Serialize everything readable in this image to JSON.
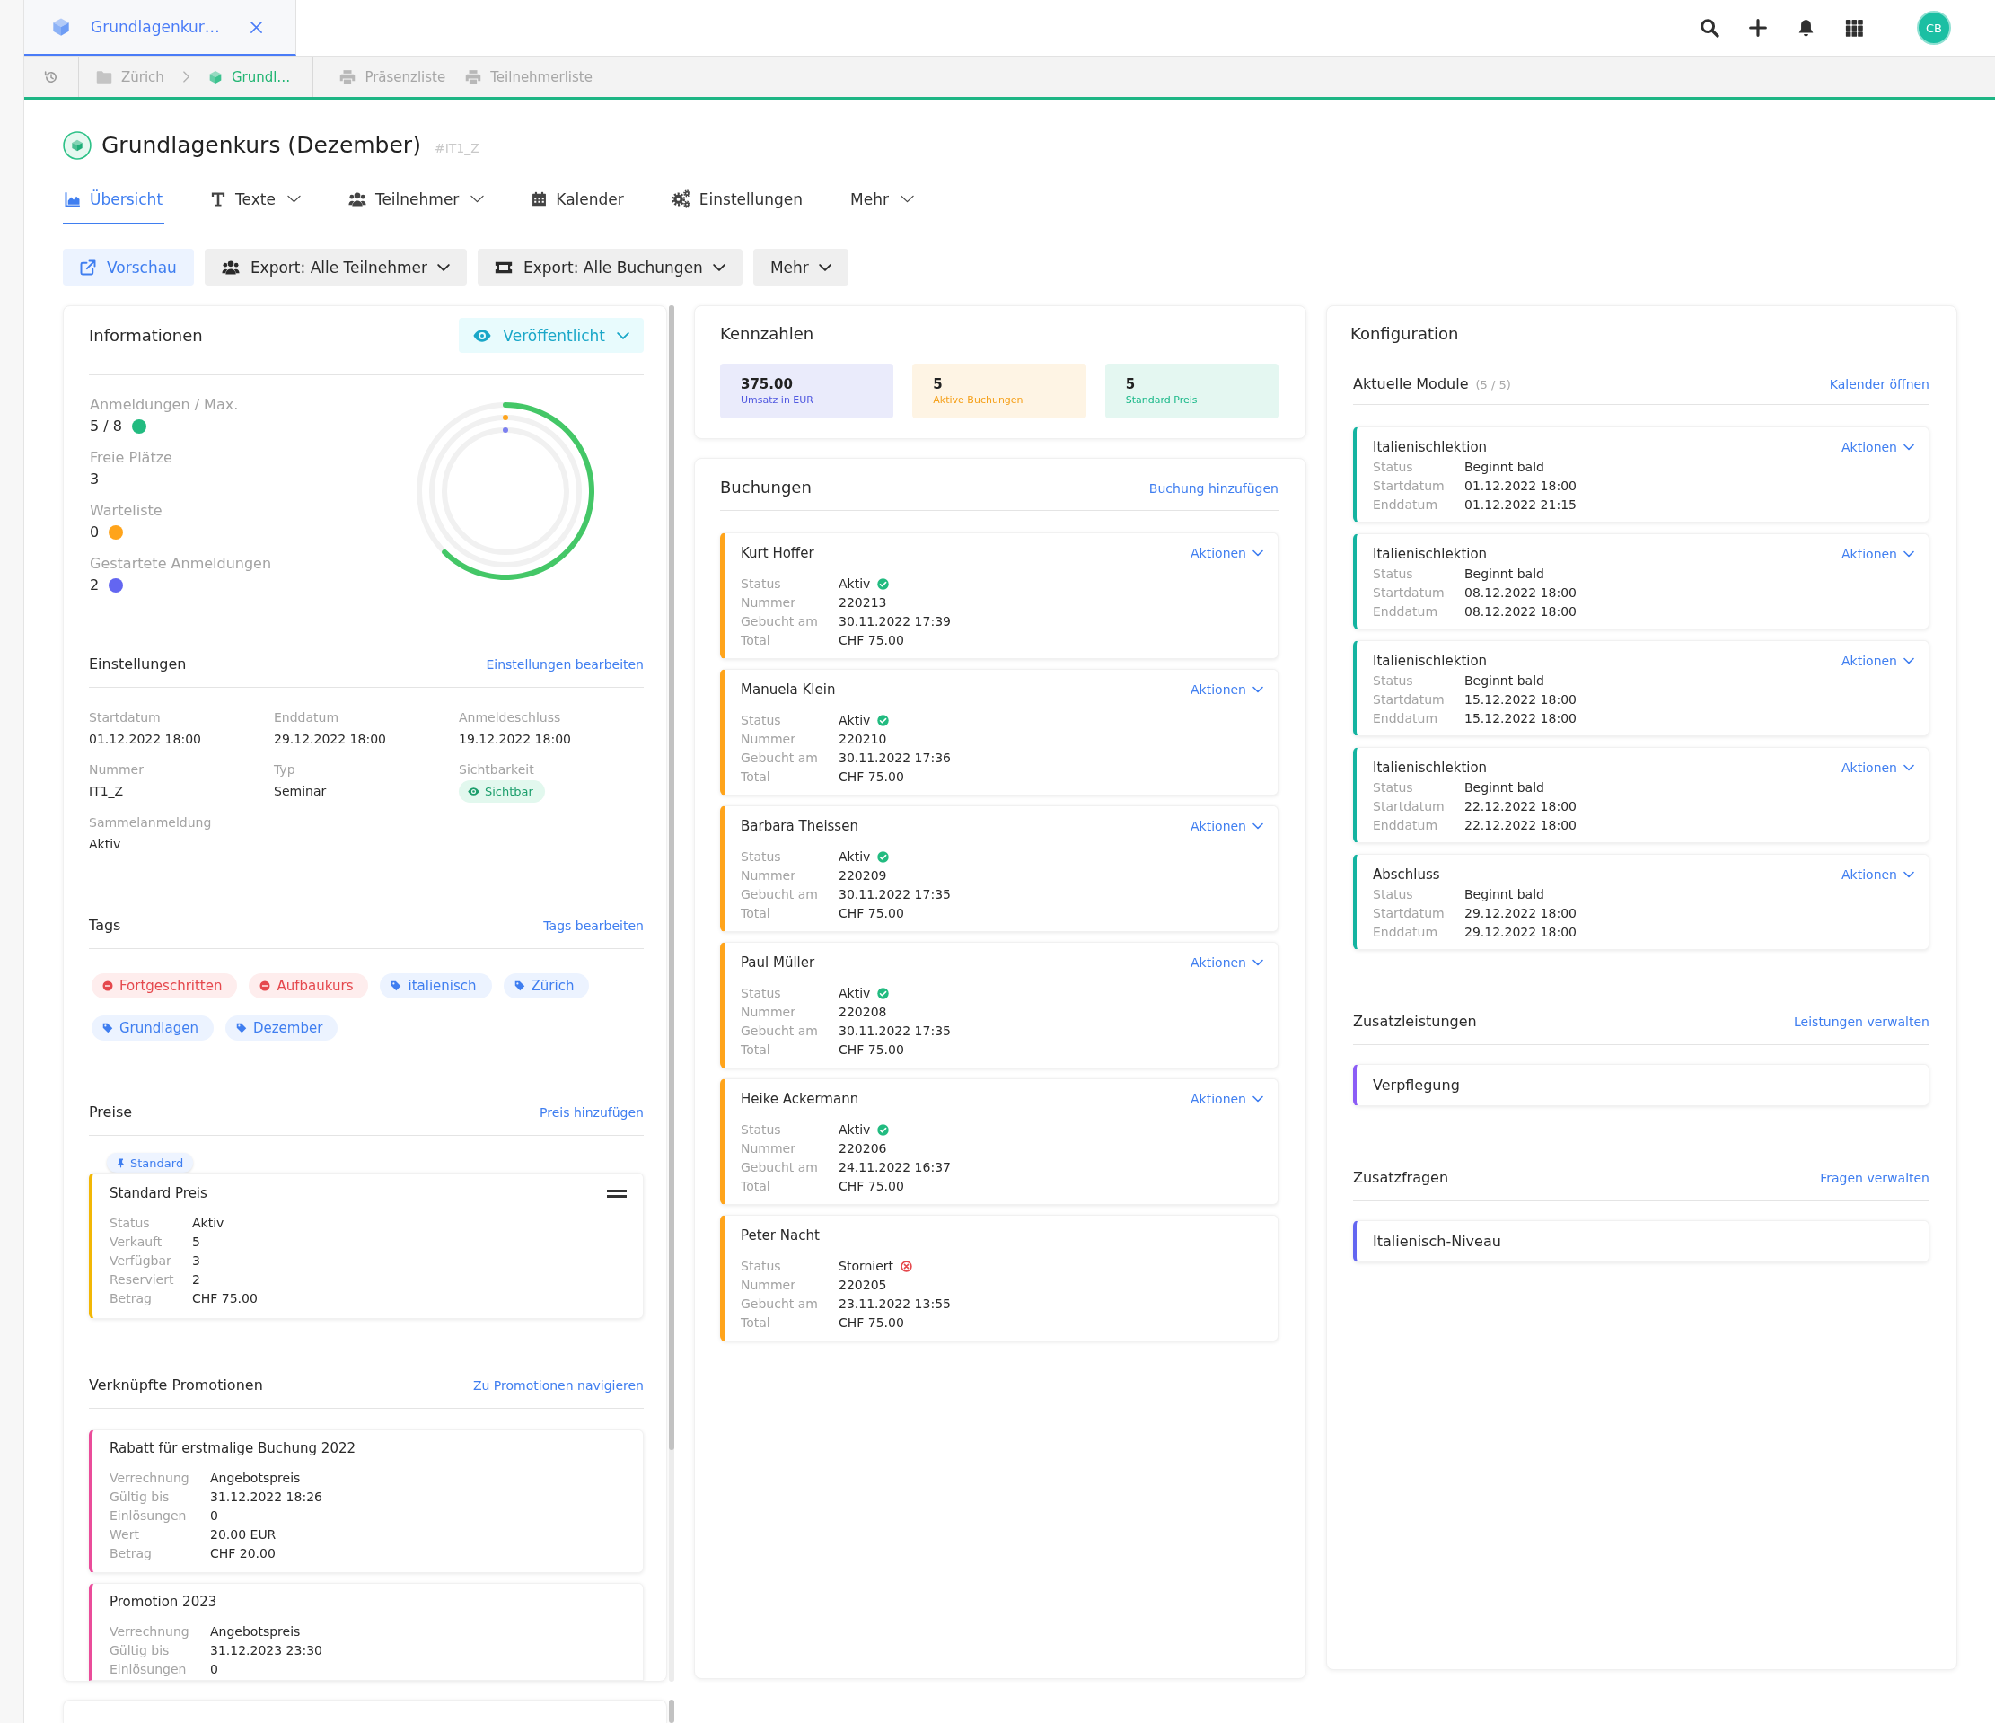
{
  "document_tab": {
    "title": "Grundlagenkur…",
    "selected": true
  },
  "user": {
    "initials": "CB"
  },
  "breadcrumb": {
    "items": [
      {
        "label": "Zürich",
        "kind": "folder"
      },
      {
        "label": "Grundl…",
        "kind": "course"
      }
    ],
    "actions": [
      {
        "label": "Präsenzliste"
      },
      {
        "label": "Teilnehmerliste"
      }
    ]
  },
  "header": {
    "title": "Grundlagenkurs (Dezember)",
    "code": "#IT1_Z"
  },
  "nav_tabs": [
    {
      "label": "Übersicht",
      "kind": "overview",
      "has_menu": false,
      "selected": true
    },
    {
      "label": "Texte",
      "kind": "texts",
      "has_menu": true,
      "selected": false
    },
    {
      "label": "Teilnehmer",
      "kind": "participants",
      "has_menu": true,
      "selected": false
    },
    {
      "label": "Kalender",
      "kind": "calendar",
      "has_menu": false,
      "selected": false
    },
    {
      "label": "Einstellungen",
      "kind": "settings",
      "has_menu": false,
      "selected": false
    },
    {
      "label": "Mehr",
      "kind": "more",
      "has_menu": true,
      "selected": false
    }
  ],
  "toolbar": [
    {
      "label": "Vorschau",
      "kind": "preview",
      "has_menu": false
    },
    {
      "label": "Export: Alle Teilnehmer",
      "kind": "participants",
      "has_menu": true
    },
    {
      "label": "Export: Alle Buchungen",
      "kind": "bookings",
      "has_menu": true
    },
    {
      "label": "Mehr",
      "kind": "more",
      "has_menu": true
    }
  ],
  "informationen": {
    "title": "Informationen",
    "status_button": "Veröffentlicht",
    "stats": [
      {
        "label": "Anmeldungen / Max.",
        "value": "5 / 8",
        "color": "#22bb80"
      },
      {
        "label": "Freie Plätze",
        "value": "3"
      },
      {
        "label": "Warteliste",
        "value": "0",
        "color": "#ffa41b"
      },
      {
        "label": "Gestartete Anmeldungen",
        "value": "2",
        "color": "#6366f1"
      }
    ],
    "chart_data": {
      "type": "donut",
      "values": [
        62.5,
        37.5
      ]
    },
    "rings": [
      {
        "level": 0,
        "color": "#ffa41b"
      },
      {
        "level": 0,
        "color": "#7b7ff0"
      }
    ]
  },
  "einstellungen": {
    "title": "Einstellungen",
    "link": "Einstellungen bearbeiten",
    "fields": [
      {
        "label": "Startdatum",
        "value": "01.12.2022 18:00",
        "kind": "text"
      },
      {
        "label": "Enddatum",
        "value": "29.12.2022 18:00",
        "kind": "text"
      },
      {
        "label": "Anmeldeschluss",
        "value": "19.12.2022 18:00",
        "kind": "text"
      },
      {
        "label": "Nummer",
        "value": "IT1_Z",
        "kind": "text"
      },
      {
        "label": "Typ",
        "value": "Seminar",
        "kind": "text"
      },
      {
        "label": "Sichtbarkeit",
        "value": "Sichtbar",
        "kind": "badge"
      },
      {
        "label": "Sammelanmeldung",
        "value": "Aktiv",
        "kind": "text"
      }
    ]
  },
  "tags": {
    "title": "Tags",
    "link": "Tags bearbeiten",
    "items": [
      {
        "label": "Fortgeschritten",
        "kind": "excluded"
      },
      {
        "label": "Aufbaukurs",
        "kind": "excluded"
      },
      {
        "label": "italienisch",
        "kind": "tag"
      },
      {
        "label": "Zürich",
        "kind": "tag"
      },
      {
        "label": "Grundlagen",
        "kind": "tag"
      },
      {
        "label": "Dezember",
        "kind": "tag"
      }
    ]
  },
  "preise": {
    "title": "Preise",
    "link": "Preis hinzufügen",
    "items": [
      {
        "badge": "Standard",
        "name": "Standard Preis",
        "rows": [
          {
            "label": "Status",
            "value": "Aktiv"
          },
          {
            "label": "Verkauft",
            "value": "5"
          },
          {
            "label": "Verfügbar",
            "value": "3"
          },
          {
            "label": "Reserviert",
            "value": "2"
          },
          {
            "label": "Betrag",
            "value": "CHF 75.00"
          }
        ]
      }
    ]
  },
  "promotionen": {
    "title": "Verknüpfte Promotionen",
    "link": "Zu Promotionen navigieren",
    "items": [
      {
        "name": "Rabatt für erstmalige Buchung 2022",
        "rows": [
          {
            "label": "Verrechnung",
            "value": "Angebotspreis"
          },
          {
            "label": "Gültig bis",
            "value": "31.12.2022 18:26"
          },
          {
            "label": "Einlösungen",
            "value": "0"
          },
          {
            "label": "Wert",
            "value": "20.00 EUR"
          },
          {
            "label": "Betrag",
            "value": "CHF 20.00"
          }
        ]
      },
      {
        "name": "Promotion 2023",
        "rows": [
          {
            "label": "Verrechnung",
            "value": "Angebotspreis"
          },
          {
            "label": "Gültig bis",
            "value": "31.12.2023 23:30"
          },
          {
            "label": "Einlösungen",
            "value": "0"
          }
        ]
      }
    ]
  },
  "kennzahlen": {
    "title": "Kennzahlen",
    "items": [
      {
        "value": "375.00",
        "label": "Umsatz in EUR",
        "color": "#5159e0"
      },
      {
        "value": "5",
        "label": "Aktive Buchungen",
        "color": "#f5a01a"
      },
      {
        "value": "5",
        "label": "Standard Preis",
        "color": "#1cb98a"
      }
    ]
  },
  "buchungen": {
    "title": "Buchungen",
    "link": "Buchung hinzufügen",
    "items": [
      {
        "name": "Kurt Hoffer",
        "actions": "Aktionen",
        "cancelled": false,
        "rows": [
          {
            "label": "Status",
            "value": "Aktiv"
          },
          {
            "label": "Nummer",
            "value": "220213"
          },
          {
            "label": "Gebucht am",
            "value": "30.11.2022 17:39"
          },
          {
            "label": "Total",
            "value": "CHF 75.00"
          }
        ]
      },
      {
        "name": "Manuela Klein",
        "actions": "Aktionen",
        "cancelled": false,
        "rows": [
          {
            "label": "Status",
            "value": "Aktiv"
          },
          {
            "label": "Nummer",
            "value": "220210"
          },
          {
            "label": "Gebucht am",
            "value": "30.11.2022 17:36"
          },
          {
            "label": "Total",
            "value": "CHF 75.00"
          }
        ]
      },
      {
        "name": "Barbara Theissen",
        "actions": "Aktionen",
        "cancelled": false,
        "rows": [
          {
            "label": "Status",
            "value": "Aktiv"
          },
          {
            "label": "Nummer",
            "value": "220209"
          },
          {
            "label": "Gebucht am",
            "value": "30.11.2022 17:35"
          },
          {
            "label": "Total",
            "value": "CHF 75.00"
          }
        ]
      },
      {
        "name": "Paul Müller",
        "actions": "Aktionen",
        "cancelled": false,
        "rows": [
          {
            "label": "Status",
            "value": "Aktiv"
          },
          {
            "label": "Nummer",
            "value": "220208"
          },
          {
            "label": "Gebucht am",
            "value": "30.11.2022 17:35"
          },
          {
            "label": "Total",
            "value": "CHF 75.00"
          }
        ]
      },
      {
        "name": "Heike Ackermann",
        "actions": "Aktionen",
        "cancelled": false,
        "rows": [
          {
            "label": "Status",
            "value": "Aktiv"
          },
          {
            "label": "Nummer",
            "value": "220206"
          },
          {
            "label": "Gebucht am",
            "value": "24.11.2022 16:37"
          },
          {
            "label": "Total",
            "value": "CHF 75.00"
          }
        ]
      },
      {
        "name": "Peter Nacht",
        "cancelled": true,
        "rows": [
          {
            "label": "Status",
            "value": "Storniert"
          },
          {
            "label": "Nummer",
            "value": "220205"
          },
          {
            "label": "Gebucht am",
            "value": "23.11.2022 13:55"
          },
          {
            "label": "Total",
            "value": "CHF 75.00"
          }
        ]
      }
    ]
  },
  "konfiguration": {
    "title": "Konfiguration",
    "module": {
      "title": "Aktuelle Module",
      "count": "(5 / 5)",
      "link": "Kalender öffnen",
      "items": [
        {
          "name": "Italienischlektion",
          "actions": "Aktionen",
          "rows": [
            {
              "label": "Status",
              "value": "Beginnt bald"
            },
            {
              "label": "Startdatum",
              "value": "01.12.2022 18:00"
            },
            {
              "label": "Enddatum",
              "value": "01.12.2022 21:15"
            }
          ]
        },
        {
          "name": "Italienischlektion",
          "actions": "Aktionen",
          "rows": [
            {
              "label": "Status",
              "value": "Beginnt bald"
            },
            {
              "label": "Startdatum",
              "value": "08.12.2022 18:00"
            },
            {
              "label": "Enddatum",
              "value": "08.12.2022 18:00"
            }
          ]
        },
        {
          "name": "Italienischlektion",
          "actions": "Aktionen",
          "rows": [
            {
              "label": "Status",
              "value": "Beginnt bald"
            },
            {
              "label": "Startdatum",
              "value": "15.12.2022 18:00"
            },
            {
              "label": "Enddatum",
              "value": "15.12.2022 18:00"
            }
          ]
        },
        {
          "name": "Italienischlektion",
          "actions": "Aktionen",
          "rows": [
            {
              "label": "Status",
              "value": "Beginnt bald"
            },
            {
              "label": "Startdatum",
              "value": "22.12.2022 18:00"
            },
            {
              "label": "Enddatum",
              "value": "22.12.2022 18:00"
            }
          ]
        },
        {
          "name": "Abschluss",
          "actions": "Aktionen",
          "rows": [
            {
              "label": "Status",
              "value": "Beginnt bald"
            },
            {
              "label": "Startdatum",
              "value": "29.12.2022 18:00"
            },
            {
              "label": "Enddatum",
              "value": "29.12.2022 18:00"
            }
          ]
        }
      ]
    },
    "zusatzleistungen": {
      "title": "Zusatzleistungen",
      "link": "Leistungen verwalten",
      "items": [
        {
          "name": "Verpflegung"
        }
      ]
    },
    "zusatzfragen": {
      "title": "Zusatzfragen",
      "link": "Fragen verwalten",
      "items": [
        {
          "name": "Italienisch-Niveau"
        }
      ]
    }
  }
}
